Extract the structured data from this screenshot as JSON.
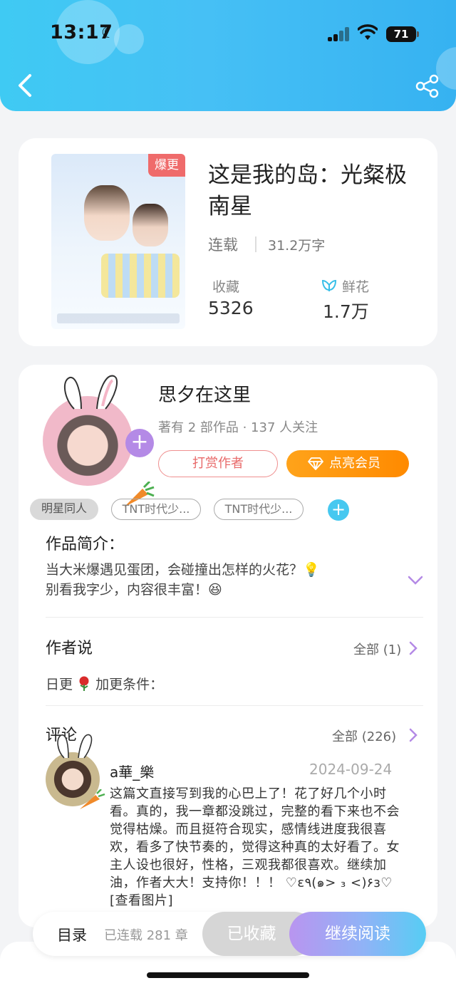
{
  "status_bar": {
    "time": "13:17",
    "battery": "71"
  },
  "book": {
    "cover_badge": "爆更",
    "title": "这是我的岛：光粲极南星",
    "status": "连载",
    "word_count": "31.2万字",
    "favorites_label": "收藏",
    "favorites_value": "5326",
    "flowers_label": "鲜花",
    "flowers_value": "1.7万"
  },
  "author": {
    "name": "思夕在这里",
    "meta": "著有 2 部作品 · 137 人关注",
    "tip_label": "打赏作者",
    "vip_label": "点亮会员"
  },
  "tags": [
    "明星同人",
    "TNT时代少...",
    "TNT时代少..."
  ],
  "intro": {
    "title": "作品简介：",
    "line1": "当大米爆遇见蛋团，会碰撞出怎样的火花？💡",
    "line2": "别看我字少，内容很丰富！😆"
  },
  "author_says": {
    "title": "作者说",
    "more": "全部 (1)",
    "text_before": "日更",
    "text_after": "加更条件："
  },
  "comments": {
    "title": "评论",
    "more": "全部 (226)",
    "item": {
      "user": "a華_樂",
      "date": "2024-09-24",
      "text": "这篇文直接写到我的心巴上了！花了好几个小时看。真的，我一章都没跳过，完整的看下来也不会觉得枯燥。而且挺符合现实，感情线进度我很喜欢，看多了快节奏的，觉得这种真的太好看了。女主人设也很好，性格，三观我都很喜欢。继续加油，作者大大！支持你！！！ ♡ε٩(๑> ₃ <)۶з♡ [查看图片]"
    }
  },
  "bottom_bar": {
    "toc_label": "目录",
    "chapter_count": "已连载 281 章",
    "favorited_label": "已收藏",
    "continue_label": "继续阅读"
  }
}
